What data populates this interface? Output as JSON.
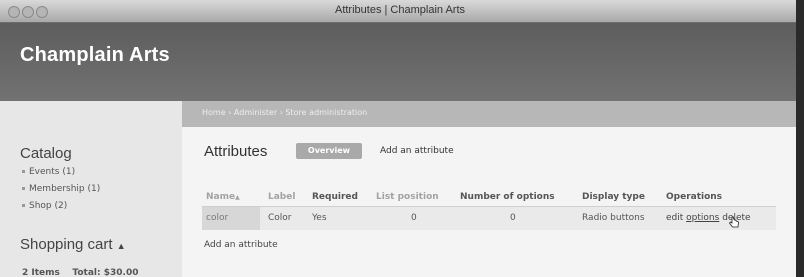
{
  "window": {
    "title": "Attributes | Champlain Arts"
  },
  "site": {
    "name": "Champlain Arts"
  },
  "breadcrumb": "Home › Administer › Store administration",
  "sidebar": {
    "catalog_heading": "Catalog",
    "catalog_items": [
      {
        "label": "Events (1)"
      },
      {
        "label": "Membership (1)"
      },
      {
        "label": "Shop (2)"
      }
    ],
    "cart_heading": "Shopping cart",
    "cart_toggle": "▲",
    "cart_summary": "2 Items    Total: $30.00"
  },
  "main": {
    "title": "Attributes",
    "tabs": [
      {
        "label": "Overview",
        "active": true
      },
      {
        "label": "Add an attribute",
        "active": false
      }
    ],
    "table": {
      "headers": [
        "Name",
        "Label",
        "Required",
        "List position",
        "Number of options",
        "Display type",
        "Operations"
      ],
      "sort_indicator": "▲",
      "rows": [
        {
          "name": "color",
          "label": "Color",
          "required": "Yes",
          "list_position": "0",
          "number_of_options": "0",
          "display_type": "Radio buttons",
          "op_edit": "edit",
          "op_options": "options",
          "op_delete": "delete"
        }
      ]
    },
    "add_link": "Add an attribute"
  },
  "colors": {
    "header": "#666666",
    "breadcrumb_bar": "#b7b7b7",
    "active_tab": "#a9a9a9"
  }
}
